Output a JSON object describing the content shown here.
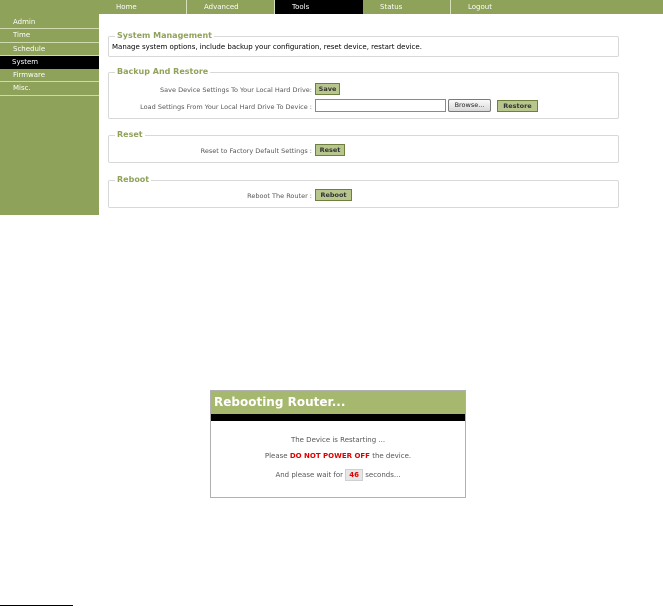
{
  "nav": {
    "tabs": [
      {
        "label": "Home"
      },
      {
        "label": "Advanced"
      },
      {
        "label": "Tools"
      },
      {
        "label": "Status"
      },
      {
        "label": "Logout"
      }
    ],
    "active_tab": "Tools"
  },
  "sidebar": {
    "items": [
      {
        "label": "Admin"
      },
      {
        "label": "Time"
      },
      {
        "label": "Schedule"
      },
      {
        "label": "System"
      },
      {
        "label": "Firmware"
      },
      {
        "label": "Misc."
      }
    ],
    "active_item": "System"
  },
  "system_management": {
    "title": "System Management",
    "description": "Manage system options, include backup your configuration, reset device, restart device."
  },
  "backup_restore": {
    "title": "Backup And Restore",
    "save_label": "Save Device Settings To Your Local Hard Drive:",
    "save_button": "Save",
    "load_label": "Load Settings From Your Local Hard Drive To Device :",
    "file_value": "",
    "browse_button": "Browse...",
    "restore_button": "Restore"
  },
  "reset": {
    "title": "Reset",
    "label": "Reset to Factory Default Settings :",
    "button": "Reset"
  },
  "reboot": {
    "title": "Reboot",
    "label": "Reboot The Router :",
    "button": "Reboot"
  },
  "dialog": {
    "title": "Rebooting Router...",
    "line1": "The Device is Restarting ...",
    "line2_prefix": "Please ",
    "line2_warning": "DO NOT POWER OFF",
    "line2_suffix": " the device.",
    "line3_prefix": "And please wait for ",
    "countdown": "46",
    "line3_suffix": " seconds..."
  },
  "colors": {
    "nav_green": "#8fa25a",
    "dialog_header": "#a6b86e",
    "warning_red": "#e00000",
    "legend_green": "#8fa25a"
  }
}
